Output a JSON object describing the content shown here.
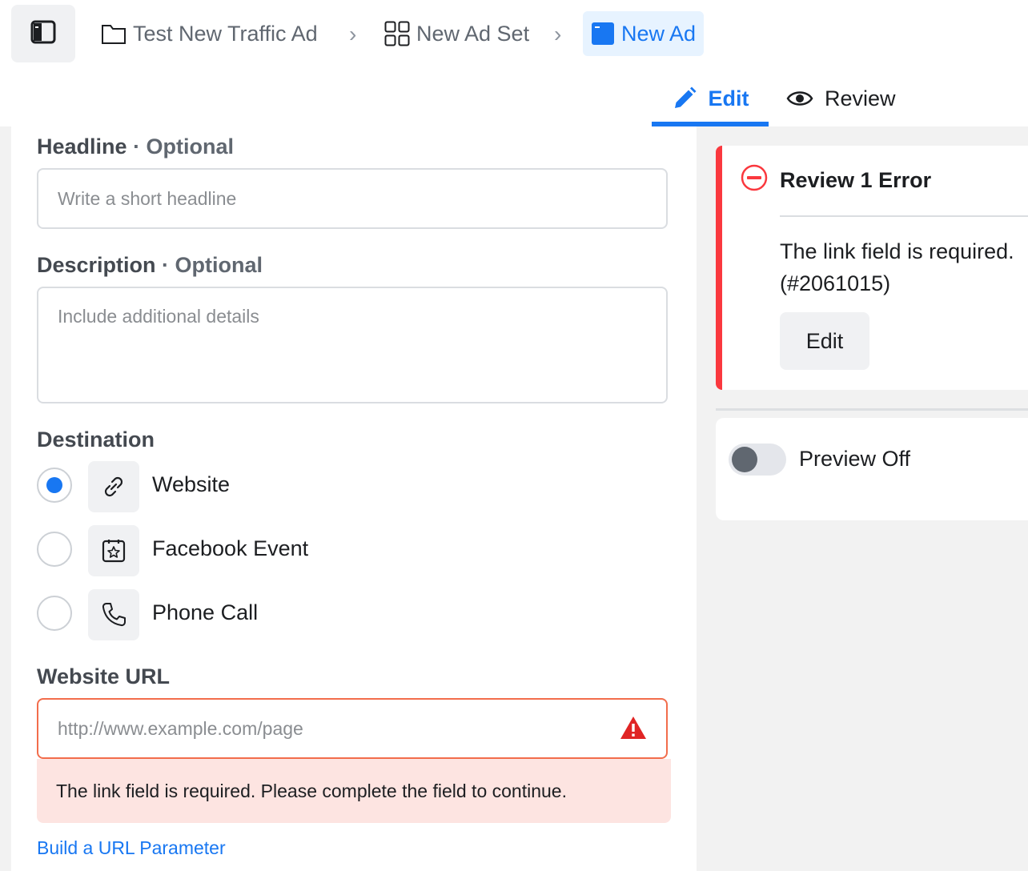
{
  "breadcrumb": {
    "campaign": "Test New Traffic Ad",
    "ad_set": "New Ad Set",
    "ad": "New Ad"
  },
  "tabs": {
    "edit": "Edit",
    "review": "Review"
  },
  "form": {
    "headline": {
      "label": "Headline",
      "optional": "· Optional",
      "placeholder": "Write a short headline"
    },
    "description": {
      "label": "Description",
      "optional": "· Optional",
      "placeholder": "Include additional details"
    },
    "destination": {
      "label": "Destination",
      "options": [
        {
          "label": "Website",
          "icon": "link-icon",
          "selected": true
        },
        {
          "label": "Facebook Event",
          "icon": "event-icon",
          "selected": false
        },
        {
          "label": "Phone Call",
          "icon": "phone-icon",
          "selected": false
        }
      ]
    },
    "website_url": {
      "label": "Website URL",
      "placeholder": "http://www.example.com/page",
      "error": "The link field is required. Please complete the field to continue."
    },
    "build_link": "Build a URL Parameter"
  },
  "review_panel": {
    "title": "Review 1 Error",
    "message": "The link field is required. (#2061015)",
    "edit_button": "Edit"
  },
  "preview": {
    "label": "Preview Off"
  },
  "colors": {
    "accent": "#1877f2",
    "error": "#fa383e",
    "error_bg": "#fde4e1",
    "warning_icon": "#e02424"
  }
}
